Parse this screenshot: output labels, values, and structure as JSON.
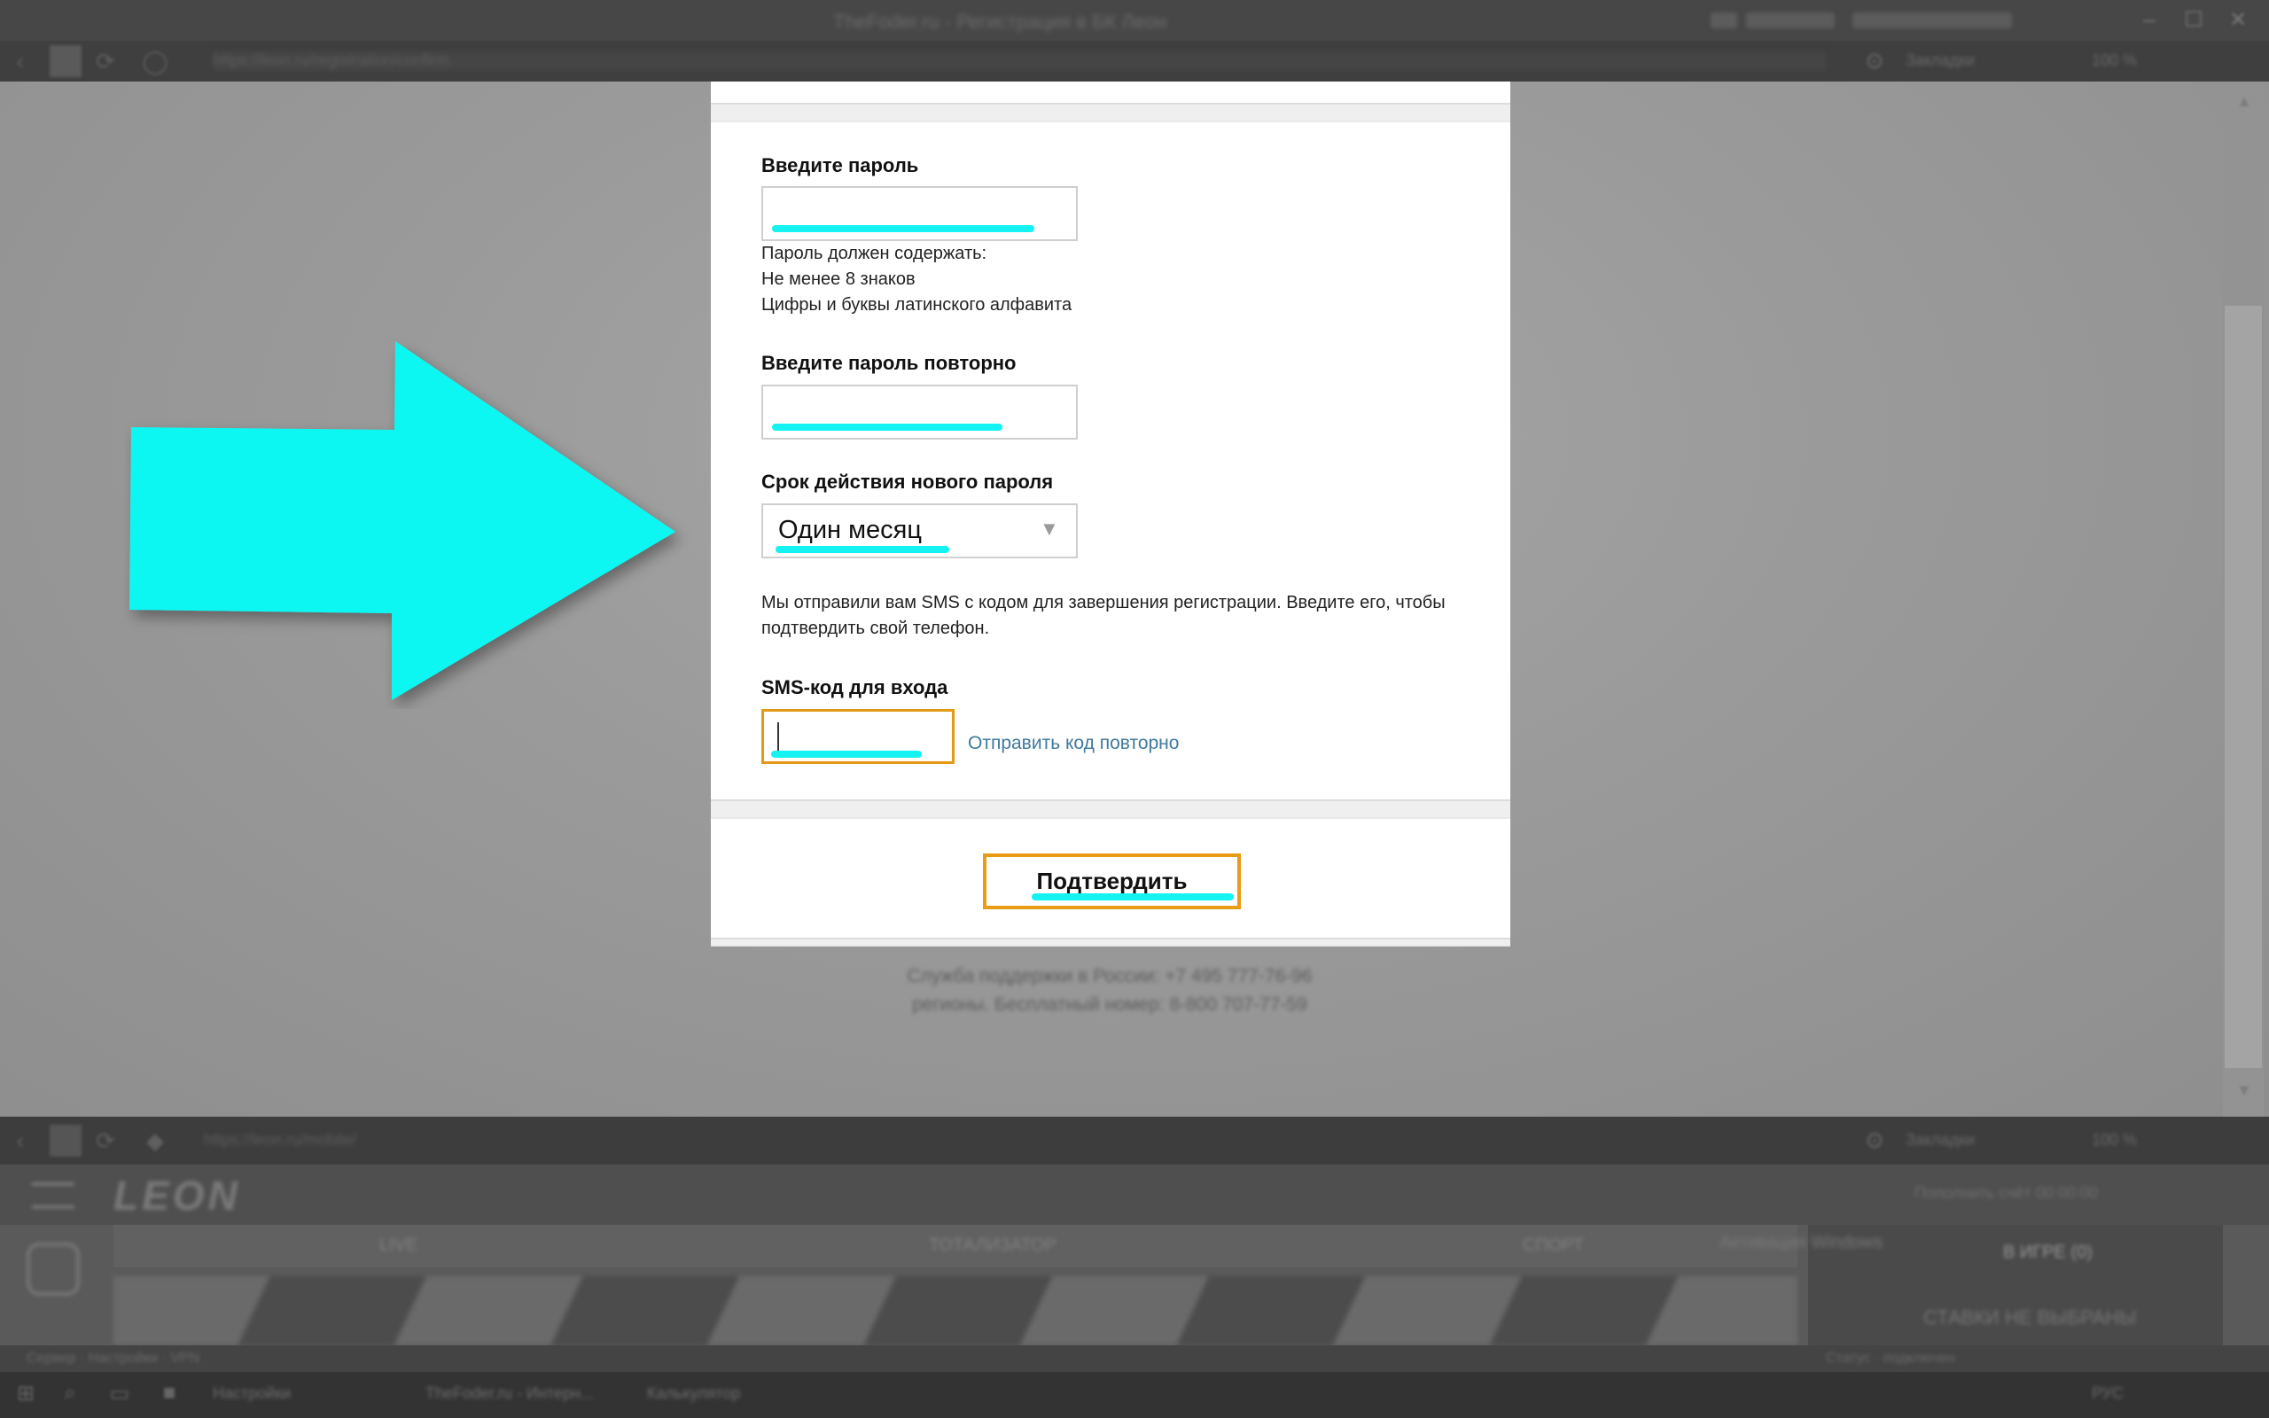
{
  "browser": {
    "title_bar": "TheFoder.ru - Регистрация в БК Леон",
    "url": "https://leon.ru/registration/confirm",
    "zoom": "100 %",
    "search_label": "Закладки"
  },
  "form": {
    "password_label": "Введите пароль",
    "password_hint_title": "Пароль должен содержать:",
    "password_hint_length": "Не менее 8 знаков",
    "password_hint_charset": "Цифры и буквы латинского алфавита",
    "repeat_password_label": "Введите пароль повторно",
    "validity_label": "Срок действия нового пароля",
    "validity_selected": "Один месяц",
    "sms_message": "Мы отправили вам SMS с кодом для завершения регистрации. Введите его, чтобы подтвердить свой телефон.",
    "sms_code_label": "SMS-код для входа",
    "resend_link": "Отправить код повторно",
    "confirm_button": "Подтвердить"
  },
  "support": {
    "line1": "Служба поддержки в России: +7 495 777-76-96",
    "line2": "регионы. Бесплатный номер: 8-800 707-77-59"
  },
  "app": {
    "logo": "LEON",
    "header_right": "Пополнить счёт   00:00:00",
    "tabs": [
      "LIVE",
      "ТОТАЛИЗАТОР",
      "СПОРТ"
    ],
    "bet_title": "В ИГРЕ (0)",
    "bet_empty": "СТАВКИ НЕ ВЫБРАНЫ",
    "side_note": "Активация Windows"
  },
  "taskbar": {
    "items": [
      "Настройки",
      "TheFoder.ru - Интерн...",
      "Калькулятор"
    ],
    "lang": "РУС"
  },
  "colors": {
    "highlight": "#15f2f2",
    "accent_border": "#ea9c15",
    "link": "#3f7a9e"
  }
}
